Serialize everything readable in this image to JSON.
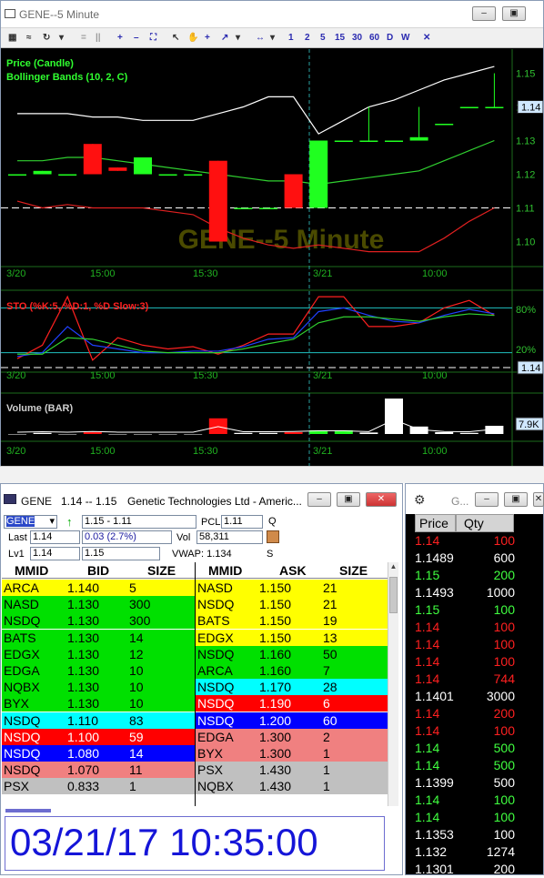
{
  "chart_window": {
    "title": "GENE--5 Minute",
    "toolbar_periods": [
      "1",
      "2",
      "5",
      "15",
      "30",
      "60",
      "D",
      "W"
    ],
    "watermark": "GENE--5 Minute",
    "price_panel": {
      "legend_price": "Price (Candle)",
      "legend_bb": "Bollinger Bands (10, 2, C)",
      "y_ticks": [
        "1.15",
        "1.14",
        "1.13",
        "1.12",
        "1.11",
        "1.10"
      ],
      "last_label": "1.14"
    },
    "sto_panel": {
      "legend": "STO (%K:5, %D:1, %D Slow:3)",
      "upper": "80%",
      "lower": "20%",
      "last_label": "1.14"
    },
    "volume_panel": {
      "legend": "Volume (BAR)",
      "last_label": "7.9K"
    },
    "x_labels": [
      "3/20",
      "15:00",
      "15:30",
      "3/21",
      "10:00"
    ]
  },
  "chart_data": [
    {
      "type": "candlestick",
      "title": "Price (Candle)",
      "ylim": [
        1.095,
        1.155
      ],
      "candles": [
        {
          "o": 1.12,
          "c": 1.12,
          "color": "green"
        },
        {
          "o": 1.12,
          "c": 1.121,
          "color": "green"
        },
        {
          "o": 1.12,
          "c": 1.12,
          "color": "green"
        },
        {
          "o": 1.129,
          "c": 1.12,
          "color": "red"
        },
        {
          "o": 1.122,
          "c": 1.121,
          "color": "red"
        },
        {
          "o": 1.12,
          "c": 1.125,
          "color": "green"
        },
        {
          "o": 1.12,
          "c": 1.12,
          "color": "green"
        },
        {
          "o": 1.12,
          "c": 1.12,
          "color": "green"
        },
        {
          "o": 1.124,
          "c": 1.1,
          "color": "red"
        },
        {
          "o": 1.11,
          "c": 1.11,
          "color": "green"
        },
        {
          "o": 1.11,
          "c": 1.11,
          "color": "green"
        },
        {
          "o": 1.12,
          "c": 1.11,
          "color": "red"
        },
        {
          "o": 1.11,
          "c": 1.13,
          "color": "green"
        },
        {
          "o": 1.13,
          "c": 1.13,
          "color": "green"
        },
        {
          "o": 1.13,
          "c": 1.13,
          "color": "green",
          "h": 1.14,
          "l": 1.13
        },
        {
          "o": 1.13,
          "c": 1.13,
          "color": "green"
        },
        {
          "o": 1.13,
          "c": 1.131,
          "color": "green",
          "h": 1.14
        },
        {
          "o": 1.135,
          "c": 1.135,
          "color": "green"
        },
        {
          "o": 1.14,
          "c": 1.14,
          "color": "green"
        },
        {
          "o": 1.14,
          "c": 1.14,
          "color": "green",
          "h": 1.15
        }
      ],
      "bb_upper": [
        1.138,
        1.138,
        1.138,
        1.137,
        1.137,
        1.136,
        1.136,
        1.136,
        1.138,
        1.14,
        1.143,
        1.143,
        1.132,
        1.136,
        1.14,
        1.142,
        1.145,
        1.148,
        1.15,
        1.152
      ],
      "bb_middle": [
        1.124,
        1.124,
        1.125,
        1.125,
        1.124,
        1.123,
        1.122,
        1.121,
        1.12,
        1.119,
        1.118,
        1.118,
        1.117,
        1.118,
        1.119,
        1.12,
        1.121,
        1.124,
        1.127,
        1.13
      ],
      "bb_lower": [
        1.112,
        1.11,
        1.111,
        1.11,
        1.11,
        1.11,
        1.109,
        1.108,
        1.104,
        1.101,
        1.099,
        1.098,
        1.099,
        1.098,
        1.097,
        1.097,
        1.097,
        1.101,
        1.106,
        1.11
      ]
    },
    {
      "type": "line",
      "title": "STO (%K:5, %D:1, %D Slow:3)",
      "ylim": [
        0,
        100
      ],
      "series": [
        {
          "color": "red",
          "values": [
            12,
            30,
            95,
            10,
            40,
            30,
            25,
            28,
            18,
            30,
            45,
            45,
            95,
            95,
            55,
            55,
            60,
            80,
            90,
            70
          ]
        },
        {
          "color": "blue",
          "values": [
            15,
            20,
            55,
            30,
            25,
            20,
            20,
            22,
            22,
            28,
            38,
            40,
            75,
            80,
            70,
            62,
            60,
            70,
            78,
            72
          ]
        },
        {
          "color": "green",
          "values": [
            18,
            18,
            40,
            38,
            30,
            22,
            20,
            20,
            20,
            25,
            32,
            38,
            60,
            68,
            68,
            65,
            62,
            68,
            72,
            70
          ]
        }
      ]
    },
    {
      "type": "bar",
      "title": "Volume (BAR)",
      "values": [
        0,
        0.3,
        0,
        0.5,
        0,
        0,
        0,
        0,
        4.2,
        0.3,
        0.3,
        0.5,
        1.0,
        1.0,
        0.4,
        9.5,
        2.0,
        0.5,
        0.3,
        2.2
      ],
      "colors": [
        "white",
        "white",
        "white",
        "red",
        "white",
        "white",
        "white",
        "white",
        "red",
        "white",
        "white",
        "red",
        "green",
        "green",
        "white",
        "white",
        "white",
        "white",
        "white",
        "white"
      ],
      "unit": "K"
    }
  ],
  "level2_window": {
    "title": "GENE",
    "title_quote": "1.14 -- 1.15",
    "title_company": "Genetic Technologies Ltd - Americ...",
    "symbol": "GENE",
    "range": "1.15 - 1.11",
    "pcl_label": "PCL",
    "pcl_value": "1.11",
    "q_label": "Q",
    "last_label": "Last",
    "last_value": "1.14",
    "change": "0.03  (2.7%)",
    "vol_label": "Vol",
    "vol_value": "58,311",
    "lv1_label": "Lv1",
    "lv1_bid": "1.14",
    "lv1_ask": "1.15",
    "vwap": "VWAP: 1.134",
    "s_label": "S",
    "bid_headers": [
      "MMID",
      "BID",
      "SIZE"
    ],
    "ask_headers": [
      "MMID",
      "ASK",
      "SIZE"
    ],
    "bids": [
      {
        "mmid": "ARCA",
        "price": "1.140",
        "size": "5",
        "bg": "#ffff00",
        "fg": "#000000"
      },
      {
        "mmid": "NASD",
        "price": "1.130",
        "size": "300",
        "bg": "#00e000",
        "fg": "#000000"
      },
      {
        "mmid": "NSDQ",
        "price": "1.130",
        "size": "300",
        "bg": "#00e000",
        "fg": "#000000"
      },
      {
        "mmid": "BATS",
        "price": "1.130",
        "size": "14",
        "bg": "#00e000",
        "fg": "#000000"
      },
      {
        "mmid": "EDGX",
        "price": "1.130",
        "size": "12",
        "bg": "#00e000",
        "fg": "#000000"
      },
      {
        "mmid": "EDGA",
        "price": "1.130",
        "size": "10",
        "bg": "#00e000",
        "fg": "#000000"
      },
      {
        "mmid": "NQBX",
        "price": "1.130",
        "size": "10",
        "bg": "#00e000",
        "fg": "#000000"
      },
      {
        "mmid": "BYX",
        "price": "1.130",
        "size": "10",
        "bg": "#00e000",
        "fg": "#000000"
      },
      {
        "mmid": "NSDQ",
        "price": "1.110",
        "size": "83",
        "bg": "#00ffff",
        "fg": "#000000"
      },
      {
        "mmid": "NSDQ",
        "price": "1.100",
        "size": "59",
        "bg": "#ff0000",
        "fg": "#ffffff"
      },
      {
        "mmid": "NSDQ",
        "price": "1.080",
        "size": "14",
        "bg": "#0000ff",
        "fg": "#ffffff"
      },
      {
        "mmid": "NSDQ",
        "price": "1.070",
        "size": "11",
        "bg": "#f08080",
        "fg": "#000000"
      },
      {
        "mmid": "PSX",
        "price": "0.833",
        "size": "1",
        "bg": "#c0c0c0",
        "fg": "#000000"
      }
    ],
    "asks": [
      {
        "mmid": "NASD",
        "price": "1.150",
        "size": "21",
        "bg": "#ffff00",
        "fg": "#000000"
      },
      {
        "mmid": "NSDQ",
        "price": "1.150",
        "size": "21",
        "bg": "#ffff00",
        "fg": "#000000"
      },
      {
        "mmid": "BATS",
        "price": "1.150",
        "size": "19",
        "bg": "#ffff00",
        "fg": "#000000"
      },
      {
        "mmid": "EDGX",
        "price": "1.150",
        "size": "13",
        "bg": "#ffff00",
        "fg": "#000000"
      },
      {
        "mmid": "NSDQ",
        "price": "1.160",
        "size": "50",
        "bg": "#00e000",
        "fg": "#000000"
      },
      {
        "mmid": "ARCA",
        "price": "1.160",
        "size": "7",
        "bg": "#00e000",
        "fg": "#000000"
      },
      {
        "mmid": "NSDQ",
        "price": "1.170",
        "size": "28",
        "bg": "#00ffff",
        "fg": "#000000"
      },
      {
        "mmid": "NSDQ",
        "price": "1.190",
        "size": "6",
        "bg": "#ff0000",
        "fg": "#ffffff"
      },
      {
        "mmid": "NSDQ",
        "price": "1.200",
        "size": "60",
        "bg": "#0000ff",
        "fg": "#ffffff"
      },
      {
        "mmid": "EDGA",
        "price": "1.300",
        "size": "2",
        "bg": "#f08080",
        "fg": "#000000"
      },
      {
        "mmid": "BYX",
        "price": "1.300",
        "size": "1",
        "bg": "#f08080",
        "fg": "#000000"
      },
      {
        "mmid": "PSX",
        "price": "1.430",
        "size": "1",
        "bg": "#c0c0c0",
        "fg": "#000000"
      },
      {
        "mmid": "NQBX",
        "price": "1.430",
        "size": "1",
        "bg": "#c0c0c0",
        "fg": "#000000"
      }
    ],
    "clock": "03/21/17 10:35:00"
  },
  "ts_window": {
    "title": "G...",
    "headers": [
      "Price",
      "Qty"
    ],
    "rows": [
      {
        "price": "1.14",
        "qty": "100",
        "color": "#ff2020"
      },
      {
        "price": "1.1489",
        "qty": "600",
        "color": "#ffffff"
      },
      {
        "price": "1.15",
        "qty": "200",
        "color": "#40ff40"
      },
      {
        "price": "1.1493",
        "qty": "1000",
        "color": "#ffffff"
      },
      {
        "price": "1.15",
        "qty": "100",
        "color": "#40ff40"
      },
      {
        "price": "1.14",
        "qty": "100",
        "color": "#ff2020"
      },
      {
        "price": "1.14",
        "qty": "100",
        "color": "#ff2020"
      },
      {
        "price": "1.14",
        "qty": "100",
        "color": "#ff2020"
      },
      {
        "price": "1.14",
        "qty": "744",
        "color": "#ff2020"
      },
      {
        "price": "1.1401",
        "qty": "3000",
        "color": "#ffffff"
      },
      {
        "price": "1.14",
        "qty": "200",
        "color": "#ff2020"
      },
      {
        "price": "1.14",
        "qty": "100",
        "color": "#ff2020"
      },
      {
        "price": "1.14",
        "qty": "500",
        "color": "#40ff40"
      },
      {
        "price": "1.14",
        "qty": "500",
        "color": "#40ff40"
      },
      {
        "price": "1.1399",
        "qty": "500",
        "color": "#ffffff"
      },
      {
        "price": "1.14",
        "qty": "100",
        "color": "#40ff40"
      },
      {
        "price": "1.14",
        "qty": "100",
        "color": "#40ff40"
      },
      {
        "price": "1.1353",
        "qty": "100",
        "color": "#ffffff"
      },
      {
        "price": "1.132",
        "qty": "1274",
        "color": "#ffffff"
      },
      {
        "price": "1.1301",
        "qty": "200",
        "color": "#ffffff"
      }
    ]
  }
}
